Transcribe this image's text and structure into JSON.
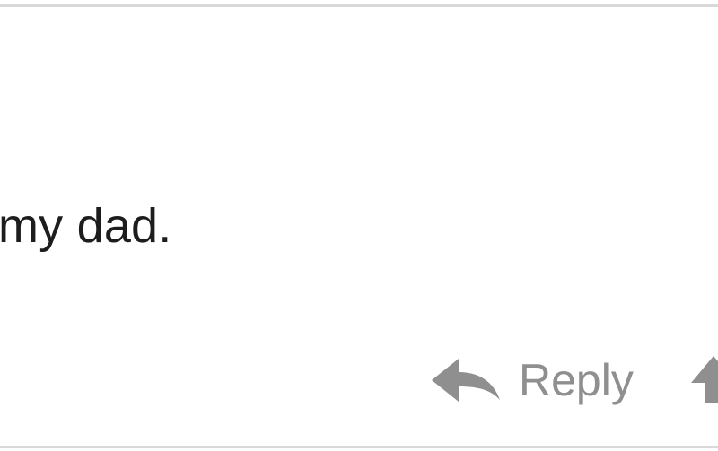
{
  "comment": {
    "text": "my dad."
  },
  "actions": {
    "reply": {
      "label": "Reply",
      "icon": "reply-arrow-icon"
    },
    "partial": {
      "icon": "upvote-arrow-icon"
    }
  },
  "colors": {
    "text": "#1d1d1d",
    "action": "#8f8f8f",
    "border": "#d9d9d9"
  }
}
